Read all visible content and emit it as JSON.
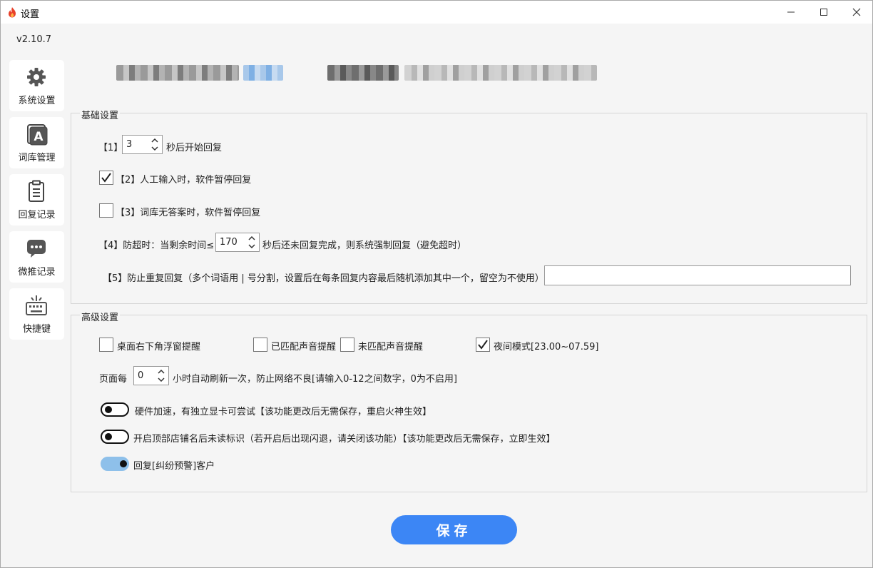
{
  "window": {
    "title": "设置",
    "controls": {
      "minimize": "—",
      "maximize": "☐",
      "close": "✕"
    }
  },
  "version": "v2.10.7",
  "sidebar": {
    "items": [
      {
        "label": "系统设置",
        "icon": "gear-icon"
      },
      {
        "label": "词库管理",
        "icon": "letter-a-icon"
      },
      {
        "label": "回复记录",
        "icon": "clipboard-icon"
      },
      {
        "label": "微推记录",
        "icon": "chat-bubble-icon"
      },
      {
        "label": "快捷键",
        "icon": "keyboard-icon"
      }
    ]
  },
  "basic": {
    "title": "基础设置",
    "s1": {
      "prefix": "【1】",
      "value": "3",
      "suffix": "秒后开始回复"
    },
    "s2": {
      "label": "【2】人工输入时，软件暂停回复",
      "checked": true
    },
    "s3": {
      "label": "【3】词库无答案时，软件暂停回复",
      "checked": false
    },
    "s4": {
      "prefix": "【4】防超时：当剩余时间≤",
      "value": "170",
      "suffix": "秒后还未回复完成，则系统强制回复（避免超时）"
    },
    "s5": {
      "label": "【5】防止重复回复（多个词语用 | 号分割，设置后在每条回复内容最后随机添加其中一个，留空为不使用）",
      "value": ""
    }
  },
  "advanced": {
    "title": "高级设置",
    "c1": {
      "label": "桌面右下角浮窗提醒",
      "checked": false
    },
    "c2": {
      "label": "已匹配声音提醒",
      "checked": false
    },
    "c3": {
      "label": "未匹配声音提醒",
      "checked": false
    },
    "c4": {
      "label": "夜间模式[23.00~07.59]",
      "checked": true
    },
    "refresh": {
      "prefix": "页面每",
      "value": "0",
      "suffix": "小时自动刷新一次，防止网络不良[请输入0-12之间数字，0为不启用]"
    },
    "t1": {
      "label": "硬件加速，有独立显卡可尝试【该功能更改后无需保存，重启火神生效】",
      "on": false
    },
    "t2": {
      "label": "开启顶部店铺名后未读标识（若开启后出现闪退，请关闭该功能）【该功能更改后无需保存，立即生效】",
      "on": false
    },
    "t3": {
      "label": "回复[纠纷预警]客户",
      "on": true
    }
  },
  "save_label": "保存",
  "colors": {
    "accent": "#3c86f5",
    "toggle_on": "#8ec0ea"
  }
}
